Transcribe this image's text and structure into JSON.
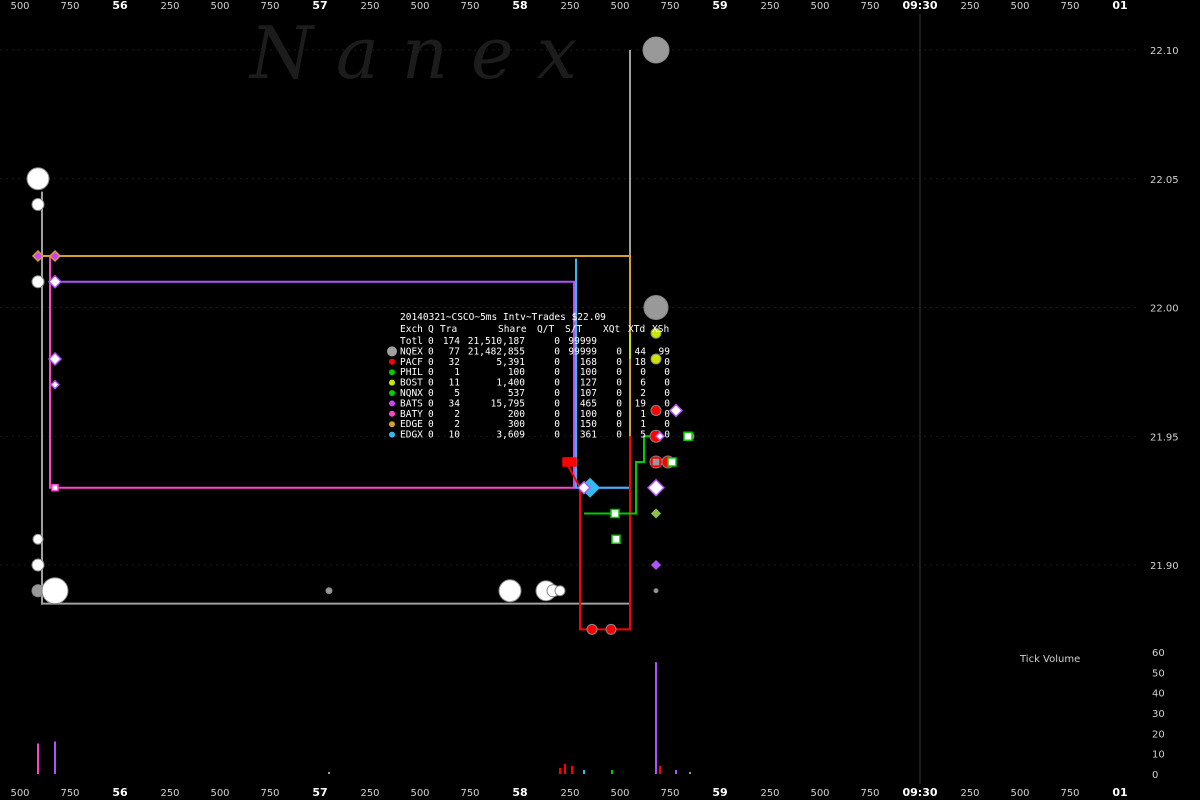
{
  "watermark": "N  a  n  e  x",
  "chart_data": {
    "type": "line",
    "title": "20140321~CSCO~5ms Intv~Trades $22.09",
    "x_axis": {
      "top_labels": [
        "500",
        "750",
        "56",
        "250",
        "500",
        "750",
        "57",
        "250",
        "500",
        "750",
        "58",
        "250",
        "500",
        "750",
        "59",
        "250",
        "500",
        "750",
        "09:30",
        "250",
        "500",
        "750",
        "01"
      ],
      "bottom_labels": [
        "500",
        "750",
        "56",
        "250",
        "500",
        "750",
        "57",
        "250",
        "500",
        "750",
        "58",
        "250",
        "500",
        "750",
        "59",
        "250",
        "500",
        "750",
        "09:30",
        "250",
        "500",
        "750",
        "01"
      ],
      "major_labels": [
        "56",
        "57",
        "58",
        "59",
        "09:30",
        "01"
      ],
      "range_ms": [
        -250,
        5000
      ]
    },
    "y_axis": {
      "tick_labels": [
        "22.10",
        "22.05",
        "22.00",
        "21.95",
        "21.90"
      ],
      "ticks": [
        22.1,
        22.05,
        22.0,
        21.95,
        21.9
      ],
      "range": [
        21.872,
        22.106
      ]
    },
    "volume_axis": {
      "label": "Tick Volume",
      "tick_labels": [
        "60",
        "50",
        "40",
        "30",
        "20",
        "10",
        "0"
      ],
      "ticks": [
        60,
        50,
        40,
        30,
        20,
        10,
        0
      ]
    },
    "stats_table": {
      "header": [
        "Exch",
        "Q",
        "Tra",
        "Share",
        "Q/T",
        "S/T",
        "XQt",
        "XTd",
        "XSh"
      ],
      "rows": [
        {
          "exch": "Totl",
          "q": "0",
          "tra": "174",
          "share": "21,510,187",
          "qt": "0",
          "st": "99999",
          "xqt": "",
          "xtd": "",
          "xsh": "",
          "color": ""
        },
        {
          "exch": "NQEX",
          "q": "0",
          "tra": "77",
          "share": "21,482,855",
          "qt": "0",
          "st": "99999",
          "xqt": "0",
          "xtd": "44",
          "xsh": "99",
          "color": "#a0a0a0"
        },
        {
          "exch": "PACF",
          "q": "0",
          "tra": "32",
          "share": "5,391",
          "qt": "0",
          "st": "168",
          "xqt": "0",
          "xtd": "18",
          "xsh": "0",
          "color": "#ff0000"
        },
        {
          "exch": "PHIL",
          "q": "0",
          "tra": "1",
          "share": "100",
          "qt": "0",
          "st": "100",
          "xqt": "0",
          "xtd": "0",
          "xsh": "0",
          "color": "#00cc00"
        },
        {
          "exch": "BOST",
          "q": "0",
          "tra": "11",
          "share": "1,400",
          "qt": "0",
          "st": "127",
          "xqt": "0",
          "xtd": "6",
          "xsh": "0",
          "color": "#c8e600"
        },
        {
          "exch": "NQNX",
          "q": "0",
          "tra": "5",
          "share": "537",
          "qt": "0",
          "st": "107",
          "xqt": "0",
          "xtd": "2",
          "xsh": "0",
          "color": "#00cc00"
        },
        {
          "exch": "BATS",
          "q": "0",
          "tra": "34",
          "share": "15,795",
          "qt": "0",
          "st": "465",
          "xqt": "0",
          "xtd": "19",
          "xsh": "0",
          "color": "#cc44ff"
        },
        {
          "exch": "BATY",
          "q": "0",
          "tra": "2",
          "share": "200",
          "qt": "0",
          "st": "100",
          "xqt": "0",
          "xtd": "1",
          "xsh": "0",
          "color": "#ff44cc"
        },
        {
          "exch": "EDGE",
          "q": "0",
          "tra": "2",
          "share": "300",
          "qt": "0",
          "st": "150",
          "xqt": "0",
          "xtd": "1",
          "xsh": "0",
          "color": "#d4a030"
        },
        {
          "exch": "EDGX",
          "q": "0",
          "tra": "10",
          "share": "3,609",
          "qt": "0",
          "st": "361",
          "xqt": "0",
          "xtd": "5",
          "xsh": "0",
          "color": "#33bbee"
        }
      ]
    },
    "series": [
      {
        "name": "NQEX",
        "color": "#a0a0a0",
        "points": [
          [
            110,
            22.045
          ],
          [
            110,
            21.885
          ],
          [
            190,
            21.885
          ],
          [
            3050,
            21.885
          ],
          [
            3050,
            22.1
          ]
        ]
      },
      {
        "name": "EDGE",
        "color": "#d4a030",
        "points": [
          [
            110,
            22.02
          ],
          [
            3050,
            22.02
          ],
          [
            3050,
            21.94
          ]
        ]
      },
      {
        "name": "BATS",
        "color": "#b050ff",
        "points": [
          [
            150,
            22.01
          ],
          [
            2770,
            22.01
          ],
          [
            2770,
            21.93
          ],
          [
            3050,
            21.93
          ],
          [
            3050,
            21.9
          ]
        ]
      },
      {
        "name": "BATY",
        "color": "#ff44cc",
        "points": [
          [
            150,
            22.02
          ],
          [
            150,
            21.93
          ],
          [
            2770,
            21.93
          ]
        ]
      },
      {
        "name": "EDGX",
        "color": "#33bbee",
        "points": [
          [
            2780,
            22.019
          ],
          [
            2780,
            21.93
          ],
          [
            3050,
            21.93
          ]
        ]
      },
      {
        "name": "PACF",
        "color": "#ff0000",
        "points": [
          [
            2730,
            21.94
          ],
          [
            2800,
            21.93
          ],
          [
            2800,
            21.875
          ],
          [
            3050,
            21.875
          ],
          [
            3050,
            21.95
          ]
        ]
      },
      {
        "name": "NQNX",
        "color": "#00cc00",
        "points": [
          [
            2820,
            21.92
          ],
          [
            3080,
            21.92
          ],
          [
            3080,
            21.94
          ],
          [
            3120,
            21.94
          ],
          [
            3120,
            21.95
          ],
          [
            3180,
            21.95
          ]
        ]
      },
      {
        "name": "BOST",
        "color": "#c8e600",
        "points": [
          [
            3050,
            21.99
          ],
          [
            3050,
            21.98
          ]
        ]
      }
    ],
    "grid": true,
    "legend": "top-left"
  }
}
